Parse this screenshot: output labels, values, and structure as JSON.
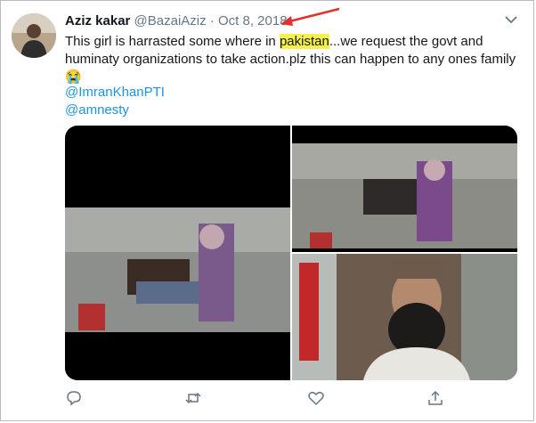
{
  "tweet": {
    "author_name": "Aziz kakar",
    "handle": "@BazaiAziz",
    "separator": "·",
    "date": "Oct 8, 2018",
    "text_before": "This girl is harrasted  some where in ",
    "highlight": "pakistan",
    "text_after": "...we request the govt and huminaty organizations to take action.plz this can happen to any ones family 😭",
    "mentions": [
      "@ImranKhanPTI",
      "@amnesty"
    ]
  },
  "colors": {
    "link": "#1b95e0",
    "highlight": "#f5f04a",
    "annotation_arrow": "#e0312b",
    "muted": "#657786"
  },
  "icons": {
    "menu": "chevron-down-icon",
    "reply": "reply-icon",
    "retweet": "retweet-icon",
    "like": "heart-icon",
    "share": "share-icon"
  }
}
